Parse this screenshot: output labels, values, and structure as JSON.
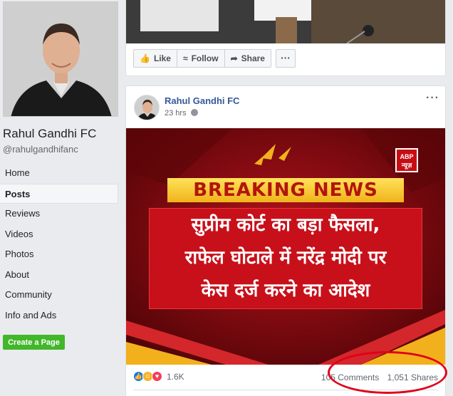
{
  "sidebar": {
    "page_name": "Rahul Gandhi FC",
    "page_handle": "@rahulgandhifanc",
    "items": [
      {
        "label": "Home"
      },
      {
        "label": "Posts"
      },
      {
        "label": "Reviews"
      },
      {
        "label": "Videos"
      },
      {
        "label": "Photos"
      },
      {
        "label": "About"
      },
      {
        "label": "Community"
      },
      {
        "label": "Info and Ads"
      }
    ],
    "active_item": "Posts",
    "create_page_label": "Create a Page"
  },
  "top_card": {
    "actions": [
      {
        "label": "Like",
        "icon": "thumbs-up-icon"
      },
      {
        "label": "Follow",
        "icon": "rss-icon"
      },
      {
        "label": "Share",
        "icon": "share-arrow-icon"
      }
    ],
    "more_label": "···"
  },
  "post": {
    "author": "Rahul Gandhi FC",
    "time": "23 hrs",
    "menu_label": "···",
    "image": {
      "headline": "BREAKING NEWS",
      "logo_lines": [
        "ABP",
        "न्यूज़"
      ],
      "hindi_lines": [
        "सुप्रीम कोर्ट का बड़ा फैसला,",
        "राफेल घोटाले में नरेंद्र मोदी पर",
        "केस दर्ज करने का आदेश"
      ]
    },
    "reaction_count": "1.6K",
    "comments": "105 Comments",
    "shares": "1,051 Shares"
  },
  "colors": {
    "link": "#365899",
    "create_button": "#42b72a",
    "highlight": "#e0001a"
  }
}
